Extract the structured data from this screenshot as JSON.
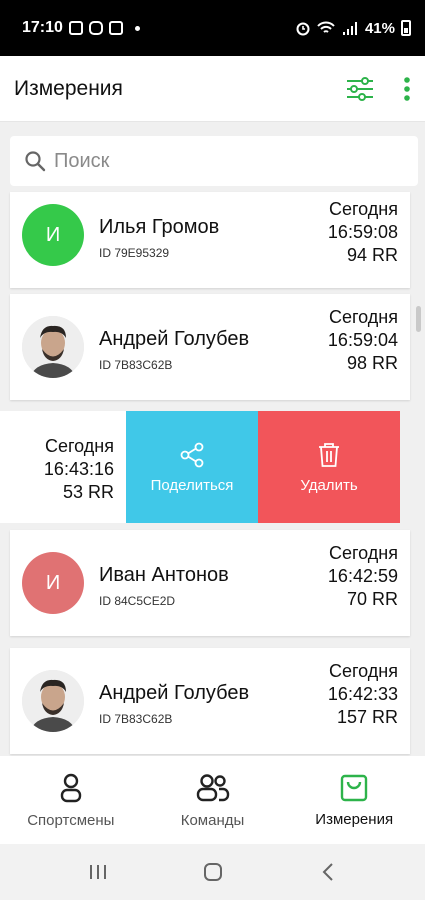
{
  "status_bar": {
    "time": "17:10",
    "battery": "41%"
  },
  "app_bar": {
    "title": "Измерения"
  },
  "search": {
    "placeholder": "Поиск"
  },
  "measurements": [
    {
      "initial": "И",
      "name": "Илья Громов",
      "id": "ID 79E95329",
      "day": "Сегодня",
      "time": "16:59:08",
      "value": "94 RR",
      "avatar_color": "#35c94a"
    },
    {
      "name": "Андрей Голубев",
      "id": "ID 7B83C62B",
      "day": "Сегодня",
      "time": "16:59:04",
      "value": "98 RR"
    },
    {
      "day": "Сегодня",
      "time": "16:43:16",
      "value": "53 RR"
    },
    {
      "initial": "И",
      "name": "Иван Антонов",
      "id": "ID 84C5CE2D",
      "day": "Сегодня",
      "time": "16:42:59",
      "value": "70 RR",
      "avatar_color": "#e07273"
    },
    {
      "name": "Андрей Голубев",
      "id": "ID 7B83C62B",
      "day": "Сегодня",
      "time": "16:42:33",
      "value": "157 RR"
    }
  ],
  "swipe_actions": {
    "share_label": "Поделиться",
    "delete_label": "Удалить",
    "share_color": "#40c8e8",
    "delete_color": "#f2555a"
  },
  "bottom_nav": [
    {
      "label": "Спортсмены",
      "icon": "person-icon"
    },
    {
      "label": "Команды",
      "icon": "people-icon"
    },
    {
      "label": "Измерения",
      "icon": "bag-icon",
      "active": true
    }
  ],
  "colors": {
    "accent": "#2db34a"
  }
}
